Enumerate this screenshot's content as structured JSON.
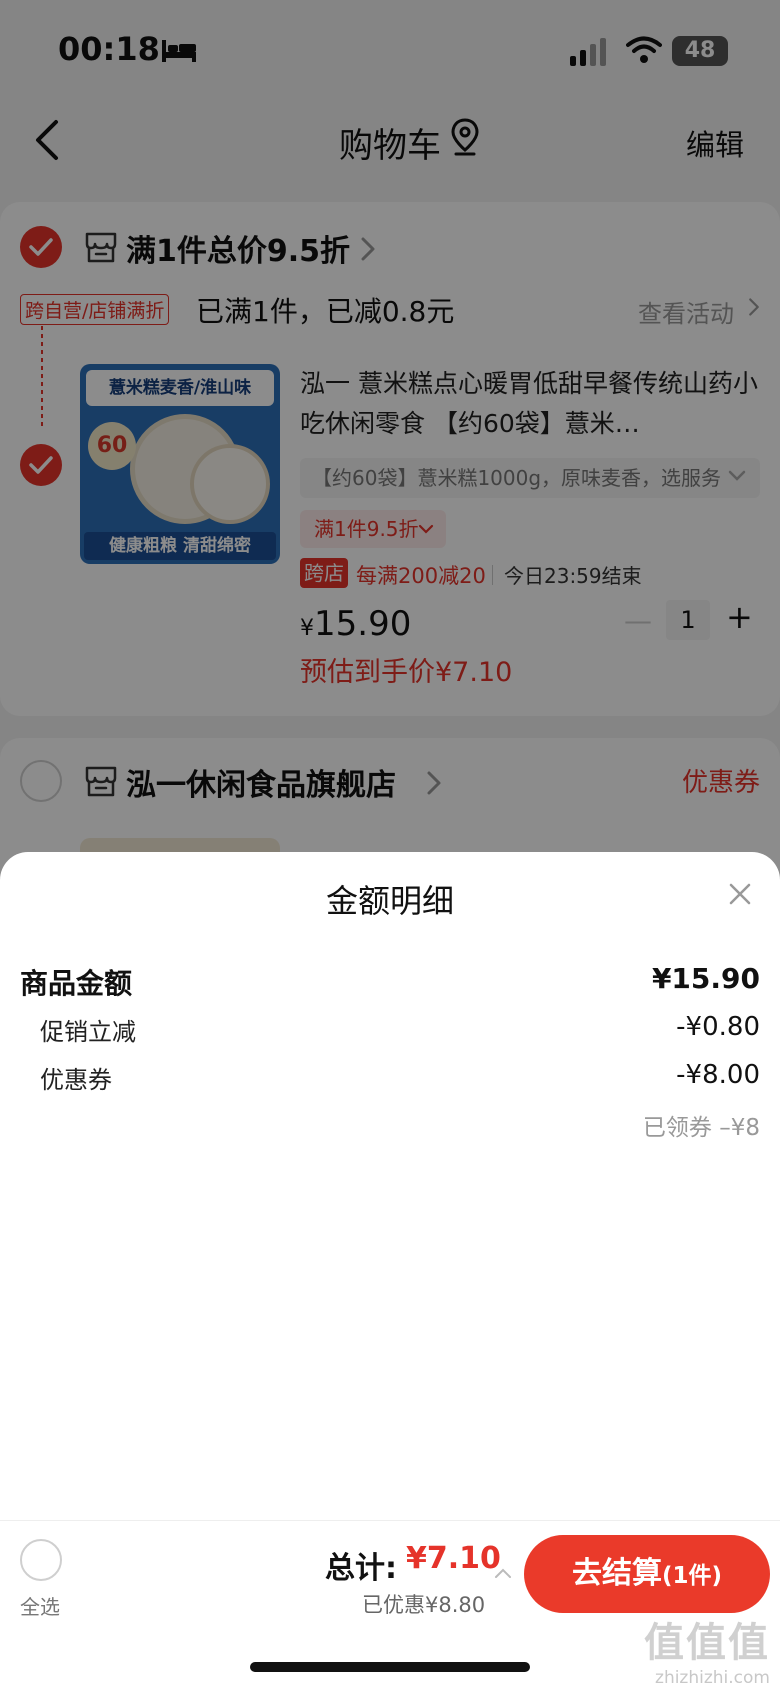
{
  "status_bar": {
    "time": "00:18",
    "battery": "48"
  },
  "nav": {
    "title": "购物车",
    "edit": "编辑"
  },
  "promo_group": {
    "title": "满1件总价9.5折",
    "tag": "跨自营/店铺满折",
    "reached": "已满1件，已减0.8元",
    "view_activity": "查看活动"
  },
  "product": {
    "image_banner": "薏米糕麦香/淮山味",
    "image_badge": "60",
    "image_footer": "健康粗粮 清甜绵密",
    "title": "泓一 薏米糕点心暖胃低甜早餐传统山药小吃休闲零食 【约60袋】薏米…",
    "spec": "【约60袋】薏米糕1000g，原味麦香，选服务",
    "promo_pill": "满1件9.5折",
    "cross_tag": "跨店",
    "cross_text": "每满200减20",
    "end_text": "今日23:59结束",
    "currency": "¥",
    "price": "15.90",
    "qty_minus": "—",
    "quantity": "1",
    "qty_plus": "+",
    "est_price": "预估到手价¥7.10"
  },
  "store": {
    "name": "泓一休闲食品旗舰店",
    "coupon": "优惠券"
  },
  "sheet": {
    "title": "金额明细",
    "rows": [
      {
        "label": "商品金额",
        "value": "¥15.90"
      },
      {
        "label": "促销立减",
        "value": "-¥0.80"
      },
      {
        "label": "优惠券",
        "value": "-¥8.00"
      }
    ],
    "coupon_hint": "已领券 –¥8"
  },
  "bottom": {
    "select_all": "全选",
    "total_label": "总计:",
    "total_value": "¥7.10",
    "discount": "已优惠¥8.80",
    "checkout": "去结算",
    "checkout_count": "(1件)"
  },
  "watermark": {
    "big": "值值值",
    "small": "zhizhizhi.com"
  },
  "colors": {
    "accent": "#e5332a",
    "checkout": "#ea3a2a"
  }
}
